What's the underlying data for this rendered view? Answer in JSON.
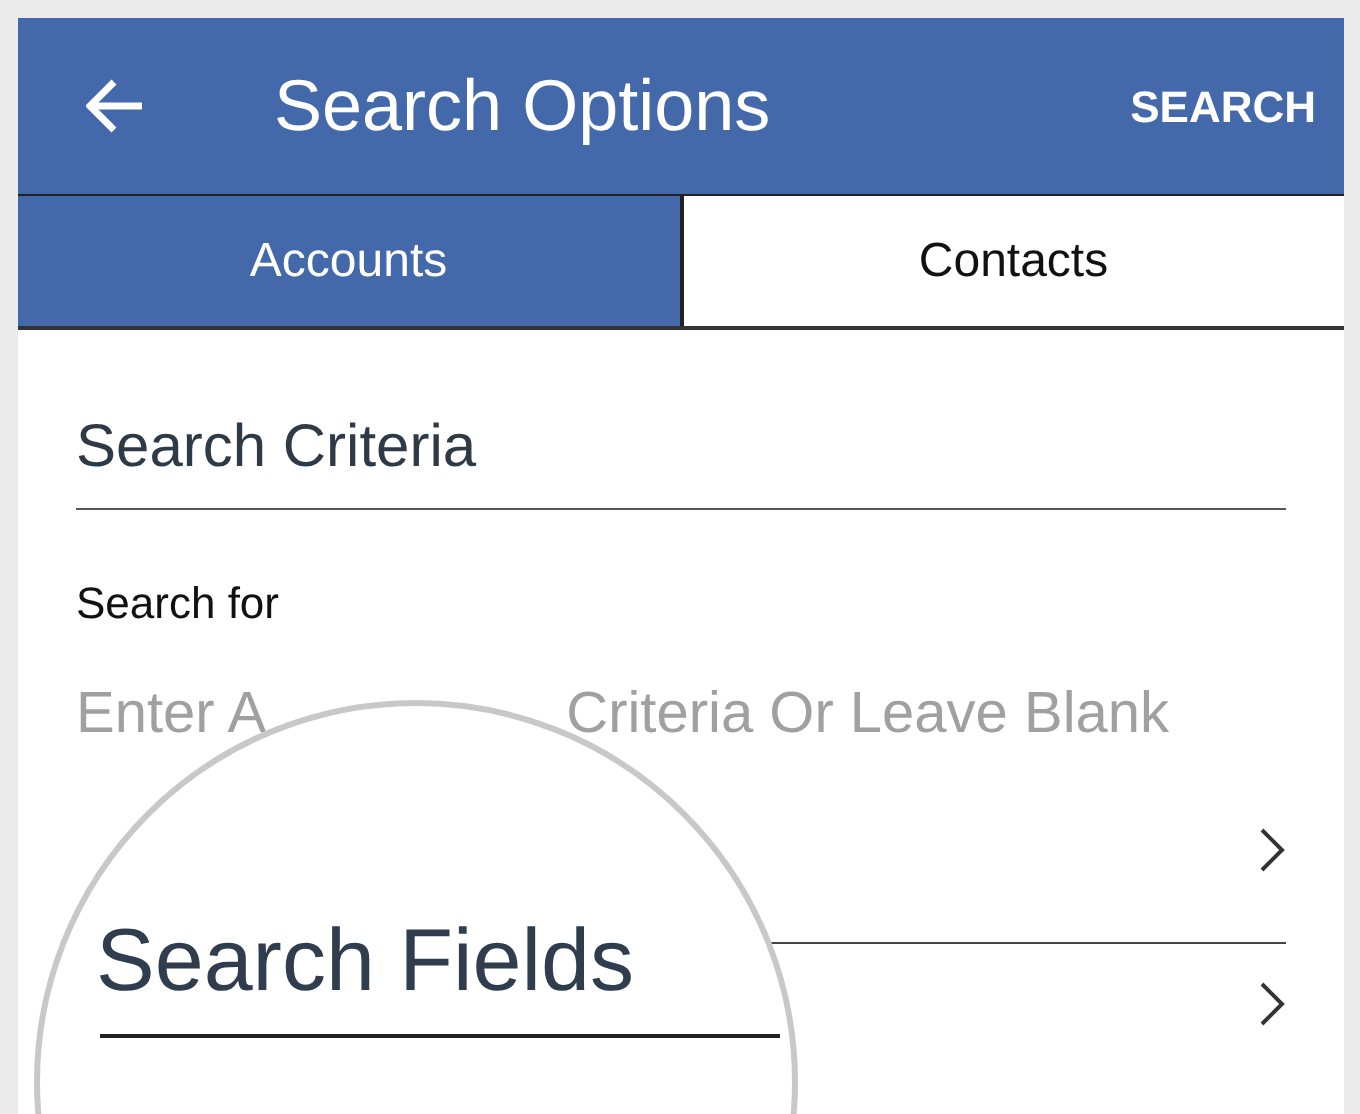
{
  "header": {
    "title": "Search Options",
    "action": "SEARCH"
  },
  "tabs": [
    {
      "label": "Accounts",
      "selected": true
    },
    {
      "label": "Contacts",
      "selected": false
    }
  ],
  "section_title": "Search Criteria",
  "search_for": {
    "label": "Search for",
    "placeholder_visible": [
      "Enter A",
      "Criteria Or Leave Blank"
    ]
  },
  "magnifier": {
    "label": "Search Fields"
  }
}
